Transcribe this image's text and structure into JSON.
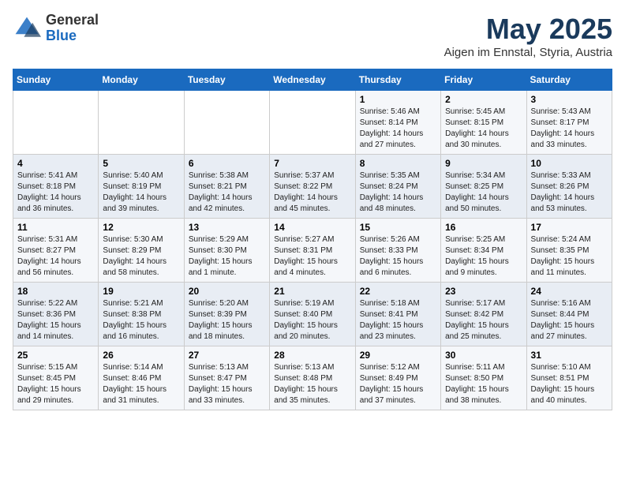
{
  "header": {
    "logo": {
      "general": "General",
      "blue": "Blue"
    },
    "title": "May 2025",
    "location": "Aigen im Ennstal, Styria, Austria"
  },
  "calendar": {
    "days_of_week": [
      "Sunday",
      "Monday",
      "Tuesday",
      "Wednesday",
      "Thursday",
      "Friday",
      "Saturday"
    ],
    "weeks": [
      [
        {
          "day": "",
          "content": ""
        },
        {
          "day": "",
          "content": ""
        },
        {
          "day": "",
          "content": ""
        },
        {
          "day": "",
          "content": ""
        },
        {
          "day": "1",
          "content": "Sunrise: 5:46 AM\nSunset: 8:14 PM\nDaylight: 14 hours and 27 minutes."
        },
        {
          "day": "2",
          "content": "Sunrise: 5:45 AM\nSunset: 8:15 PM\nDaylight: 14 hours and 30 minutes."
        },
        {
          "day": "3",
          "content": "Sunrise: 5:43 AM\nSunset: 8:17 PM\nDaylight: 14 hours and 33 minutes."
        }
      ],
      [
        {
          "day": "4",
          "content": "Sunrise: 5:41 AM\nSunset: 8:18 PM\nDaylight: 14 hours and 36 minutes."
        },
        {
          "day": "5",
          "content": "Sunrise: 5:40 AM\nSunset: 8:19 PM\nDaylight: 14 hours and 39 minutes."
        },
        {
          "day": "6",
          "content": "Sunrise: 5:38 AM\nSunset: 8:21 PM\nDaylight: 14 hours and 42 minutes."
        },
        {
          "day": "7",
          "content": "Sunrise: 5:37 AM\nSunset: 8:22 PM\nDaylight: 14 hours and 45 minutes."
        },
        {
          "day": "8",
          "content": "Sunrise: 5:35 AM\nSunset: 8:24 PM\nDaylight: 14 hours and 48 minutes."
        },
        {
          "day": "9",
          "content": "Sunrise: 5:34 AM\nSunset: 8:25 PM\nDaylight: 14 hours and 50 minutes."
        },
        {
          "day": "10",
          "content": "Sunrise: 5:33 AM\nSunset: 8:26 PM\nDaylight: 14 hours and 53 minutes."
        }
      ],
      [
        {
          "day": "11",
          "content": "Sunrise: 5:31 AM\nSunset: 8:27 PM\nDaylight: 14 hours and 56 minutes."
        },
        {
          "day": "12",
          "content": "Sunrise: 5:30 AM\nSunset: 8:29 PM\nDaylight: 14 hours and 58 minutes."
        },
        {
          "day": "13",
          "content": "Sunrise: 5:29 AM\nSunset: 8:30 PM\nDaylight: 15 hours and 1 minute."
        },
        {
          "day": "14",
          "content": "Sunrise: 5:27 AM\nSunset: 8:31 PM\nDaylight: 15 hours and 4 minutes."
        },
        {
          "day": "15",
          "content": "Sunrise: 5:26 AM\nSunset: 8:33 PM\nDaylight: 15 hours and 6 minutes."
        },
        {
          "day": "16",
          "content": "Sunrise: 5:25 AM\nSunset: 8:34 PM\nDaylight: 15 hours and 9 minutes."
        },
        {
          "day": "17",
          "content": "Sunrise: 5:24 AM\nSunset: 8:35 PM\nDaylight: 15 hours and 11 minutes."
        }
      ],
      [
        {
          "day": "18",
          "content": "Sunrise: 5:22 AM\nSunset: 8:36 PM\nDaylight: 15 hours and 14 minutes."
        },
        {
          "day": "19",
          "content": "Sunrise: 5:21 AM\nSunset: 8:38 PM\nDaylight: 15 hours and 16 minutes."
        },
        {
          "day": "20",
          "content": "Sunrise: 5:20 AM\nSunset: 8:39 PM\nDaylight: 15 hours and 18 minutes."
        },
        {
          "day": "21",
          "content": "Sunrise: 5:19 AM\nSunset: 8:40 PM\nDaylight: 15 hours and 20 minutes."
        },
        {
          "day": "22",
          "content": "Sunrise: 5:18 AM\nSunset: 8:41 PM\nDaylight: 15 hours and 23 minutes."
        },
        {
          "day": "23",
          "content": "Sunrise: 5:17 AM\nSunset: 8:42 PM\nDaylight: 15 hours and 25 minutes."
        },
        {
          "day": "24",
          "content": "Sunrise: 5:16 AM\nSunset: 8:44 PM\nDaylight: 15 hours and 27 minutes."
        }
      ],
      [
        {
          "day": "25",
          "content": "Sunrise: 5:15 AM\nSunset: 8:45 PM\nDaylight: 15 hours and 29 minutes."
        },
        {
          "day": "26",
          "content": "Sunrise: 5:14 AM\nSunset: 8:46 PM\nDaylight: 15 hours and 31 minutes."
        },
        {
          "day": "27",
          "content": "Sunrise: 5:13 AM\nSunset: 8:47 PM\nDaylight: 15 hours and 33 minutes."
        },
        {
          "day": "28",
          "content": "Sunrise: 5:13 AM\nSunset: 8:48 PM\nDaylight: 15 hours and 35 minutes."
        },
        {
          "day": "29",
          "content": "Sunrise: 5:12 AM\nSunset: 8:49 PM\nDaylight: 15 hours and 37 minutes."
        },
        {
          "day": "30",
          "content": "Sunrise: 5:11 AM\nSunset: 8:50 PM\nDaylight: 15 hours and 38 minutes."
        },
        {
          "day": "31",
          "content": "Sunrise: 5:10 AM\nSunset: 8:51 PM\nDaylight: 15 hours and 40 minutes."
        }
      ]
    ]
  }
}
